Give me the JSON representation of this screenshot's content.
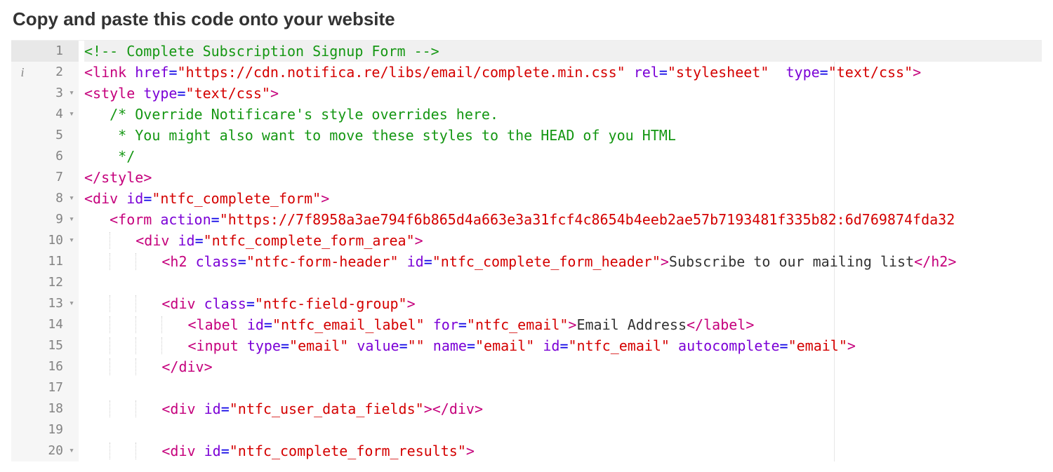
{
  "heading": "Copy and paste this code onto your website",
  "gutter": {
    "info_icon": "i",
    "fold_icon": "▾"
  },
  "rows": [
    {
      "num": 1,
      "active": true,
      "fold": false,
      "info": false,
      "indent": 0,
      "tokens": [
        {
          "c": "c",
          "t": "<!-- Complete Subscription Signup Form -->"
        }
      ]
    },
    {
      "num": 2,
      "active": false,
      "fold": false,
      "info": true,
      "indent": 0,
      "tokens": [
        {
          "c": "b",
          "t": "<"
        },
        {
          "c": "t",
          "t": "link"
        },
        {
          "c": "p",
          "t": " "
        },
        {
          "c": "a",
          "t": "href"
        },
        {
          "c": "o",
          "t": "="
        },
        {
          "c": "s",
          "t": "\"https://cdn.notifica.re/libs/email/complete.min.css\""
        },
        {
          "c": "p",
          "t": " "
        },
        {
          "c": "a",
          "t": "rel"
        },
        {
          "c": "o",
          "t": "="
        },
        {
          "c": "s",
          "t": "\"stylesheet\""
        },
        {
          "c": "p",
          "t": "  "
        },
        {
          "c": "a",
          "t": "type"
        },
        {
          "c": "o",
          "t": "="
        },
        {
          "c": "s",
          "t": "\"text/css\""
        },
        {
          "c": "b",
          "t": ">"
        }
      ]
    },
    {
      "num": 3,
      "active": false,
      "fold": true,
      "info": false,
      "indent": 0,
      "tokens": [
        {
          "c": "b",
          "t": "<"
        },
        {
          "c": "t",
          "t": "style"
        },
        {
          "c": "p",
          "t": " "
        },
        {
          "c": "a",
          "t": "type"
        },
        {
          "c": "o",
          "t": "="
        },
        {
          "c": "s",
          "t": "\"text/css\""
        },
        {
          "c": "b",
          "t": ">"
        }
      ]
    },
    {
      "num": 4,
      "active": false,
      "fold": true,
      "info": false,
      "indent": 0,
      "tokens": [
        {
          "c": "p",
          "t": "   "
        },
        {
          "c": "c",
          "t": "/* Override Notificare's style overrides here."
        }
      ]
    },
    {
      "num": 5,
      "active": false,
      "fold": false,
      "info": false,
      "indent": 0,
      "tokens": [
        {
          "c": "p",
          "t": "    "
        },
        {
          "c": "c",
          "t": "* You might also want to move these styles to the HEAD of you HTML"
        }
      ]
    },
    {
      "num": 6,
      "active": false,
      "fold": false,
      "info": false,
      "indent": 0,
      "tokens": [
        {
          "c": "p",
          "t": "    "
        },
        {
          "c": "c",
          "t": "*/"
        }
      ]
    },
    {
      "num": 7,
      "active": false,
      "fold": false,
      "info": false,
      "indent": 0,
      "tokens": [
        {
          "c": "b",
          "t": "</"
        },
        {
          "c": "t",
          "t": "style"
        },
        {
          "c": "b",
          "t": ">"
        }
      ]
    },
    {
      "num": 8,
      "active": false,
      "fold": true,
      "info": false,
      "indent": 0,
      "tokens": [
        {
          "c": "b",
          "t": "<"
        },
        {
          "c": "t",
          "t": "div"
        },
        {
          "c": "p",
          "t": " "
        },
        {
          "c": "a",
          "t": "id"
        },
        {
          "c": "o",
          "t": "="
        },
        {
          "c": "s",
          "t": "\"ntfc_complete_form\""
        },
        {
          "c": "b",
          "t": ">"
        }
      ]
    },
    {
      "num": 9,
      "active": false,
      "fold": true,
      "info": false,
      "indent": 1,
      "tokens": [
        {
          "c": "b",
          "t": "<"
        },
        {
          "c": "t",
          "t": "form"
        },
        {
          "c": "p",
          "t": " "
        },
        {
          "c": "a",
          "t": "action"
        },
        {
          "c": "o",
          "t": "="
        },
        {
          "c": "s",
          "t": "\"https://7f8958a3ae794f6b865d4a663e3a31fcf4c8654b4eeb2ae57b7193481f335b82:6d769874fda32"
        }
      ]
    },
    {
      "num": 10,
      "active": false,
      "fold": true,
      "info": false,
      "indent": 2,
      "tokens": [
        {
          "c": "b",
          "t": "<"
        },
        {
          "c": "t",
          "t": "div"
        },
        {
          "c": "p",
          "t": " "
        },
        {
          "c": "a",
          "t": "id"
        },
        {
          "c": "o",
          "t": "="
        },
        {
          "c": "s",
          "t": "\"ntfc_complete_form_area\""
        },
        {
          "c": "b",
          "t": ">"
        }
      ]
    },
    {
      "num": 11,
      "active": false,
      "fold": false,
      "info": false,
      "indent": 3,
      "tokens": [
        {
          "c": "b",
          "t": "<"
        },
        {
          "c": "t",
          "t": "h2"
        },
        {
          "c": "p",
          "t": " "
        },
        {
          "c": "a",
          "t": "class"
        },
        {
          "c": "o",
          "t": "="
        },
        {
          "c": "s",
          "t": "\"ntfc-form-header\""
        },
        {
          "c": "p",
          "t": " "
        },
        {
          "c": "a",
          "t": "id"
        },
        {
          "c": "o",
          "t": "="
        },
        {
          "c": "s",
          "t": "\"ntfc_complete_form_header\""
        },
        {
          "c": "b",
          "t": ">"
        },
        {
          "c": "p",
          "t": "Subscribe to our mailing list"
        },
        {
          "c": "b",
          "t": "</"
        },
        {
          "c": "t",
          "t": "h2"
        },
        {
          "c": "b",
          "t": ">"
        }
      ]
    },
    {
      "num": 12,
      "active": false,
      "fold": false,
      "info": false,
      "indent": 0,
      "tokens": []
    },
    {
      "num": 13,
      "active": false,
      "fold": true,
      "info": false,
      "indent": 3,
      "tokens": [
        {
          "c": "b",
          "t": "<"
        },
        {
          "c": "t",
          "t": "div"
        },
        {
          "c": "p",
          "t": " "
        },
        {
          "c": "a",
          "t": "class"
        },
        {
          "c": "o",
          "t": "="
        },
        {
          "c": "s",
          "t": "\"ntfc-field-group\""
        },
        {
          "c": "b",
          "t": ">"
        }
      ]
    },
    {
      "num": 14,
      "active": false,
      "fold": false,
      "info": false,
      "indent": 4,
      "tokens": [
        {
          "c": "b",
          "t": "<"
        },
        {
          "c": "t",
          "t": "label"
        },
        {
          "c": "p",
          "t": " "
        },
        {
          "c": "a",
          "t": "id"
        },
        {
          "c": "o",
          "t": "="
        },
        {
          "c": "s",
          "t": "\"ntfc_email_label\""
        },
        {
          "c": "p",
          "t": " "
        },
        {
          "c": "a",
          "t": "for"
        },
        {
          "c": "o",
          "t": "="
        },
        {
          "c": "s",
          "t": "\"ntfc_email\""
        },
        {
          "c": "b",
          "t": ">"
        },
        {
          "c": "p",
          "t": "Email Address"
        },
        {
          "c": "b",
          "t": "</"
        },
        {
          "c": "t",
          "t": "label"
        },
        {
          "c": "b",
          "t": ">"
        }
      ]
    },
    {
      "num": 15,
      "active": false,
      "fold": false,
      "info": false,
      "indent": 4,
      "tokens": [
        {
          "c": "b",
          "t": "<"
        },
        {
          "c": "t",
          "t": "input"
        },
        {
          "c": "p",
          "t": " "
        },
        {
          "c": "a",
          "t": "type"
        },
        {
          "c": "o",
          "t": "="
        },
        {
          "c": "s",
          "t": "\"email\""
        },
        {
          "c": "p",
          "t": " "
        },
        {
          "c": "a",
          "t": "value"
        },
        {
          "c": "o",
          "t": "="
        },
        {
          "c": "s",
          "t": "\"\""
        },
        {
          "c": "p",
          "t": " "
        },
        {
          "c": "a",
          "t": "name"
        },
        {
          "c": "o",
          "t": "="
        },
        {
          "c": "s",
          "t": "\"email\""
        },
        {
          "c": "p",
          "t": " "
        },
        {
          "c": "a",
          "t": "id"
        },
        {
          "c": "o",
          "t": "="
        },
        {
          "c": "s",
          "t": "\"ntfc_email\""
        },
        {
          "c": "p",
          "t": " "
        },
        {
          "c": "a",
          "t": "autocomplete"
        },
        {
          "c": "o",
          "t": "="
        },
        {
          "c": "s",
          "t": "\"email\""
        },
        {
          "c": "b",
          "t": ">"
        }
      ]
    },
    {
      "num": 16,
      "active": false,
      "fold": false,
      "info": false,
      "indent": 3,
      "tokens": [
        {
          "c": "b",
          "t": "</"
        },
        {
          "c": "t",
          "t": "div"
        },
        {
          "c": "b",
          "t": ">"
        }
      ]
    },
    {
      "num": 17,
      "active": false,
      "fold": false,
      "info": false,
      "indent": 0,
      "tokens": []
    },
    {
      "num": 18,
      "active": false,
      "fold": false,
      "info": false,
      "indent": 3,
      "tokens": [
        {
          "c": "b",
          "t": "<"
        },
        {
          "c": "t",
          "t": "div"
        },
        {
          "c": "p",
          "t": " "
        },
        {
          "c": "a",
          "t": "id"
        },
        {
          "c": "o",
          "t": "="
        },
        {
          "c": "s",
          "t": "\"ntfc_user_data_fields\""
        },
        {
          "c": "b",
          "t": "></"
        },
        {
          "c": "t",
          "t": "div"
        },
        {
          "c": "b",
          "t": ">"
        }
      ]
    },
    {
      "num": 19,
      "active": false,
      "fold": false,
      "info": false,
      "indent": 0,
      "tokens": []
    },
    {
      "num": 20,
      "active": false,
      "fold": true,
      "info": false,
      "indent": 3,
      "tokens": [
        {
          "c": "b",
          "t": "<"
        },
        {
          "c": "t",
          "t": "div"
        },
        {
          "c": "p",
          "t": " "
        },
        {
          "c": "a",
          "t": "id"
        },
        {
          "c": "o",
          "t": "="
        },
        {
          "c": "s",
          "t": "\"ntfc_complete_form_results\""
        },
        {
          "c": "b",
          "t": ">"
        }
      ]
    }
  ]
}
